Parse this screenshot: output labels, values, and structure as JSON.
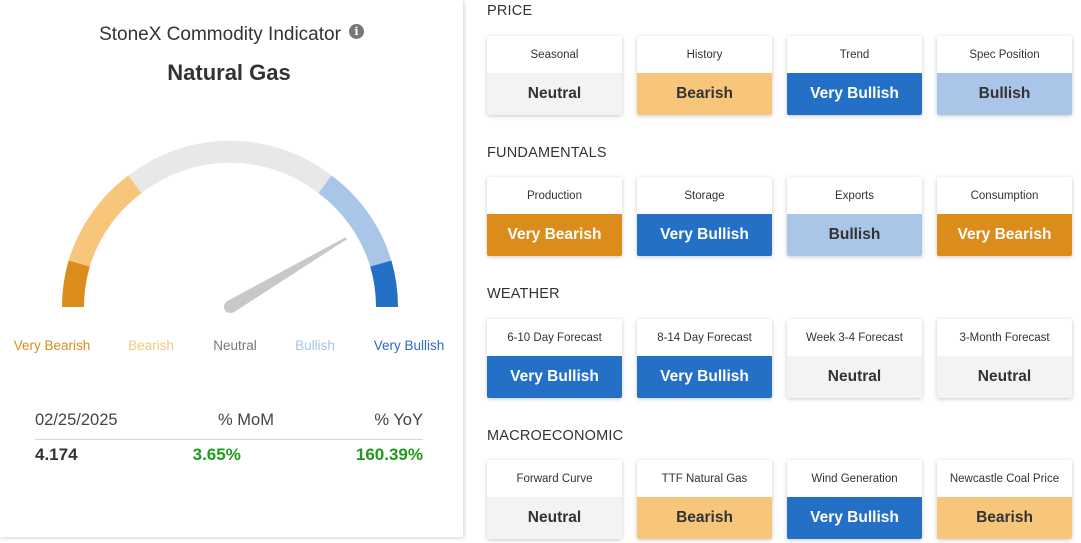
{
  "indicator": {
    "title": "StoneX Commodity Indicator",
    "info_icon": "i",
    "commodity": "Natural Gas",
    "gauge": {
      "value_fraction": 0.83,
      "colors": {
        "very_bearish": "#db8c1a",
        "bearish": "#f7c67a",
        "neutral": "#e7e8e8",
        "bullish": "#a9c5e8",
        "very_bullish": "#2570c7",
        "needle": "#c6c9c8"
      },
      "labels": {
        "very_bearish": "Very Bearish",
        "bearish": "Bearish",
        "neutral": "Neutral",
        "bullish": "Bullish",
        "very_bullish": "Very Bullish"
      }
    },
    "stats": {
      "date": "02/25/2025",
      "mom_label": "% MoM",
      "yoy_label": "% YoY",
      "price": "4.174",
      "mom": "3.65%",
      "yoy": "160.39%"
    }
  },
  "sections": {
    "price": {
      "title": "PRICE",
      "cards": [
        {
          "label": "Seasonal",
          "sentiment": "Neutral"
        },
        {
          "label": "History",
          "sentiment": "Bearish"
        },
        {
          "label": "Trend",
          "sentiment": "Very Bullish"
        },
        {
          "label": "Spec Position",
          "sentiment": "Bullish"
        }
      ]
    },
    "fundamentals": {
      "title": "FUNDAMENTALS",
      "cards": [
        {
          "label": "Production",
          "sentiment": "Very Bearish"
        },
        {
          "label": "Storage",
          "sentiment": "Very Bullish"
        },
        {
          "label": "Exports",
          "sentiment": "Bullish"
        },
        {
          "label": "Consumption",
          "sentiment": "Very Bearish"
        }
      ]
    },
    "weather": {
      "title": "WEATHER",
      "cards": [
        {
          "label": "6-10 Day Forecast",
          "sentiment": "Very Bullish"
        },
        {
          "label": "8-14 Day Forecast",
          "sentiment": "Very Bullish"
        },
        {
          "label": "Week 3-4 Forecast",
          "sentiment": "Neutral"
        },
        {
          "label": "3-Month Forecast",
          "sentiment": "Neutral"
        }
      ]
    },
    "macroeconomic": {
      "title": "MACROECONOMIC",
      "cards": [
        {
          "label": "Forward Curve",
          "sentiment": "Neutral"
        },
        {
          "label": "TTF Natural Gas",
          "sentiment": "Bearish"
        },
        {
          "label": "Wind Generation",
          "sentiment": "Very Bullish"
        },
        {
          "label": "Newcastle Coal Price",
          "sentiment": "Bearish"
        }
      ]
    }
  }
}
